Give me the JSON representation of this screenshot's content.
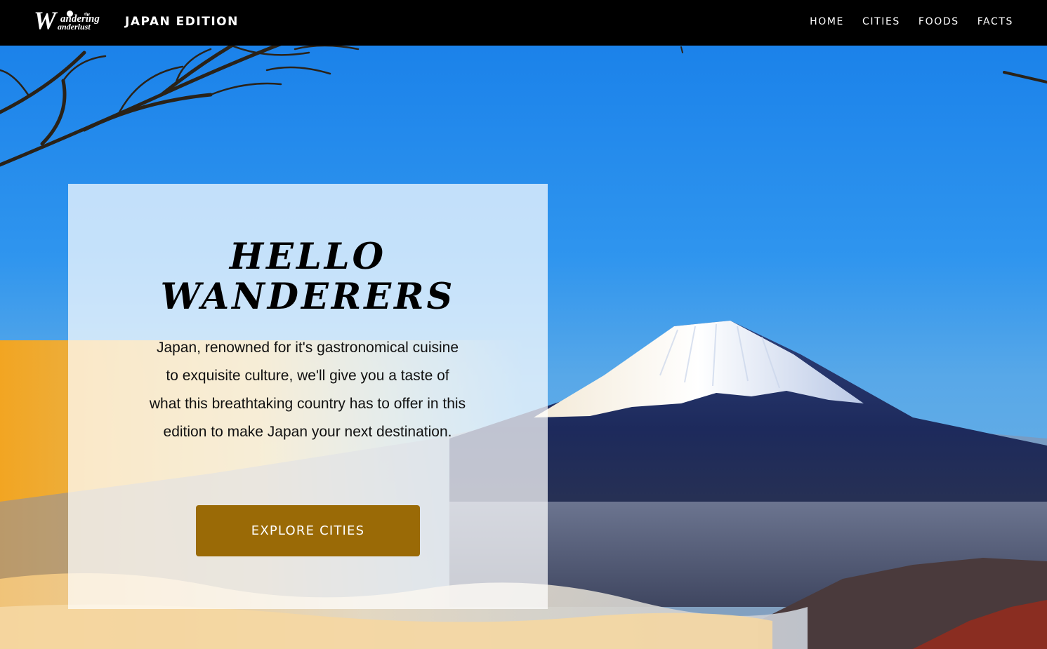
{
  "brand": {
    "logo_line1": "andering",
    "logo_line2": "anderlust",
    "logo_the": "the",
    "logo_initial": "W",
    "edition_title": "JAPAN EDITION"
  },
  "nav": {
    "items": [
      {
        "label": "HOME"
      },
      {
        "label": "CITIES"
      },
      {
        "label": "FOODS"
      },
      {
        "label": "FACTS"
      }
    ]
  },
  "hero": {
    "heading_line1": "HELLO",
    "heading_line2": "WANDERERS",
    "body": "Japan, renowned for it's gastronomical cuisine to exquisite culture, we'll give you a taste of what this breathtaking country has to offer in this edition to make Japan your next destination.",
    "cta_label": "EXPLORE CITIES",
    "background_description_icon": "mount-fuji-landscape"
  },
  "colors": {
    "navbar": "#000000",
    "cta": "#9a6a06",
    "sky_top": "#1a7fe8",
    "sunset": "#f0a828"
  }
}
